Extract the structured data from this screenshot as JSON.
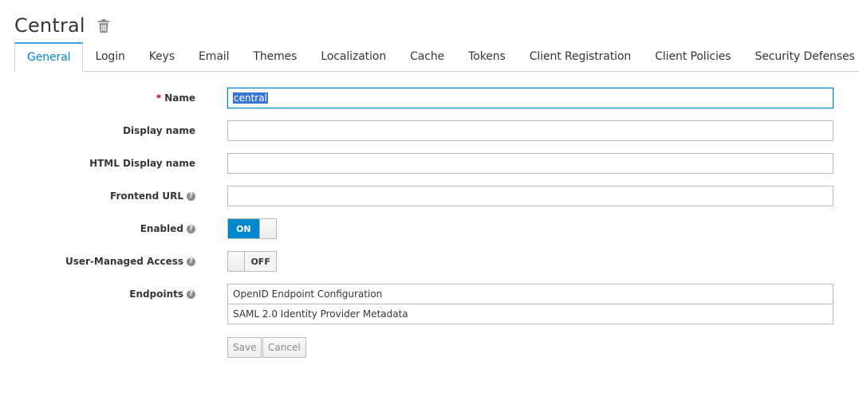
{
  "header": {
    "title": "Central",
    "delete_icon": "trash-icon"
  },
  "tabs": [
    {
      "label": "General",
      "active": true
    },
    {
      "label": "Login"
    },
    {
      "label": "Keys"
    },
    {
      "label": "Email"
    },
    {
      "label": "Themes"
    },
    {
      "label": "Localization"
    },
    {
      "label": "Cache"
    },
    {
      "label": "Tokens"
    },
    {
      "label": "Client Registration"
    },
    {
      "label": "Client Policies"
    },
    {
      "label": "Security Defenses"
    }
  ],
  "form": {
    "name": {
      "label": "Name",
      "required_mark": "*",
      "value": "central"
    },
    "display_name": {
      "label": "Display name",
      "value": ""
    },
    "html_display_name": {
      "label": "HTML Display name",
      "value": ""
    },
    "frontend_url": {
      "label": "Frontend URL",
      "value": ""
    },
    "enabled": {
      "label": "Enabled",
      "state": "ON"
    },
    "user_managed_access": {
      "label": "User-Managed Access",
      "state": "OFF"
    },
    "endpoints": {
      "label": "Endpoints",
      "items": [
        "OpenID Endpoint Configuration",
        "SAML 2.0 Identity Provider Metadata"
      ]
    },
    "help_icon_glyph": "?"
  },
  "buttons": {
    "save": "Save",
    "cancel": "Cancel"
  },
  "colors": {
    "accent": "#0088ce",
    "active_tab_border": "#39a5dc",
    "selection": "#3875d7",
    "required": "#cc0000"
  }
}
